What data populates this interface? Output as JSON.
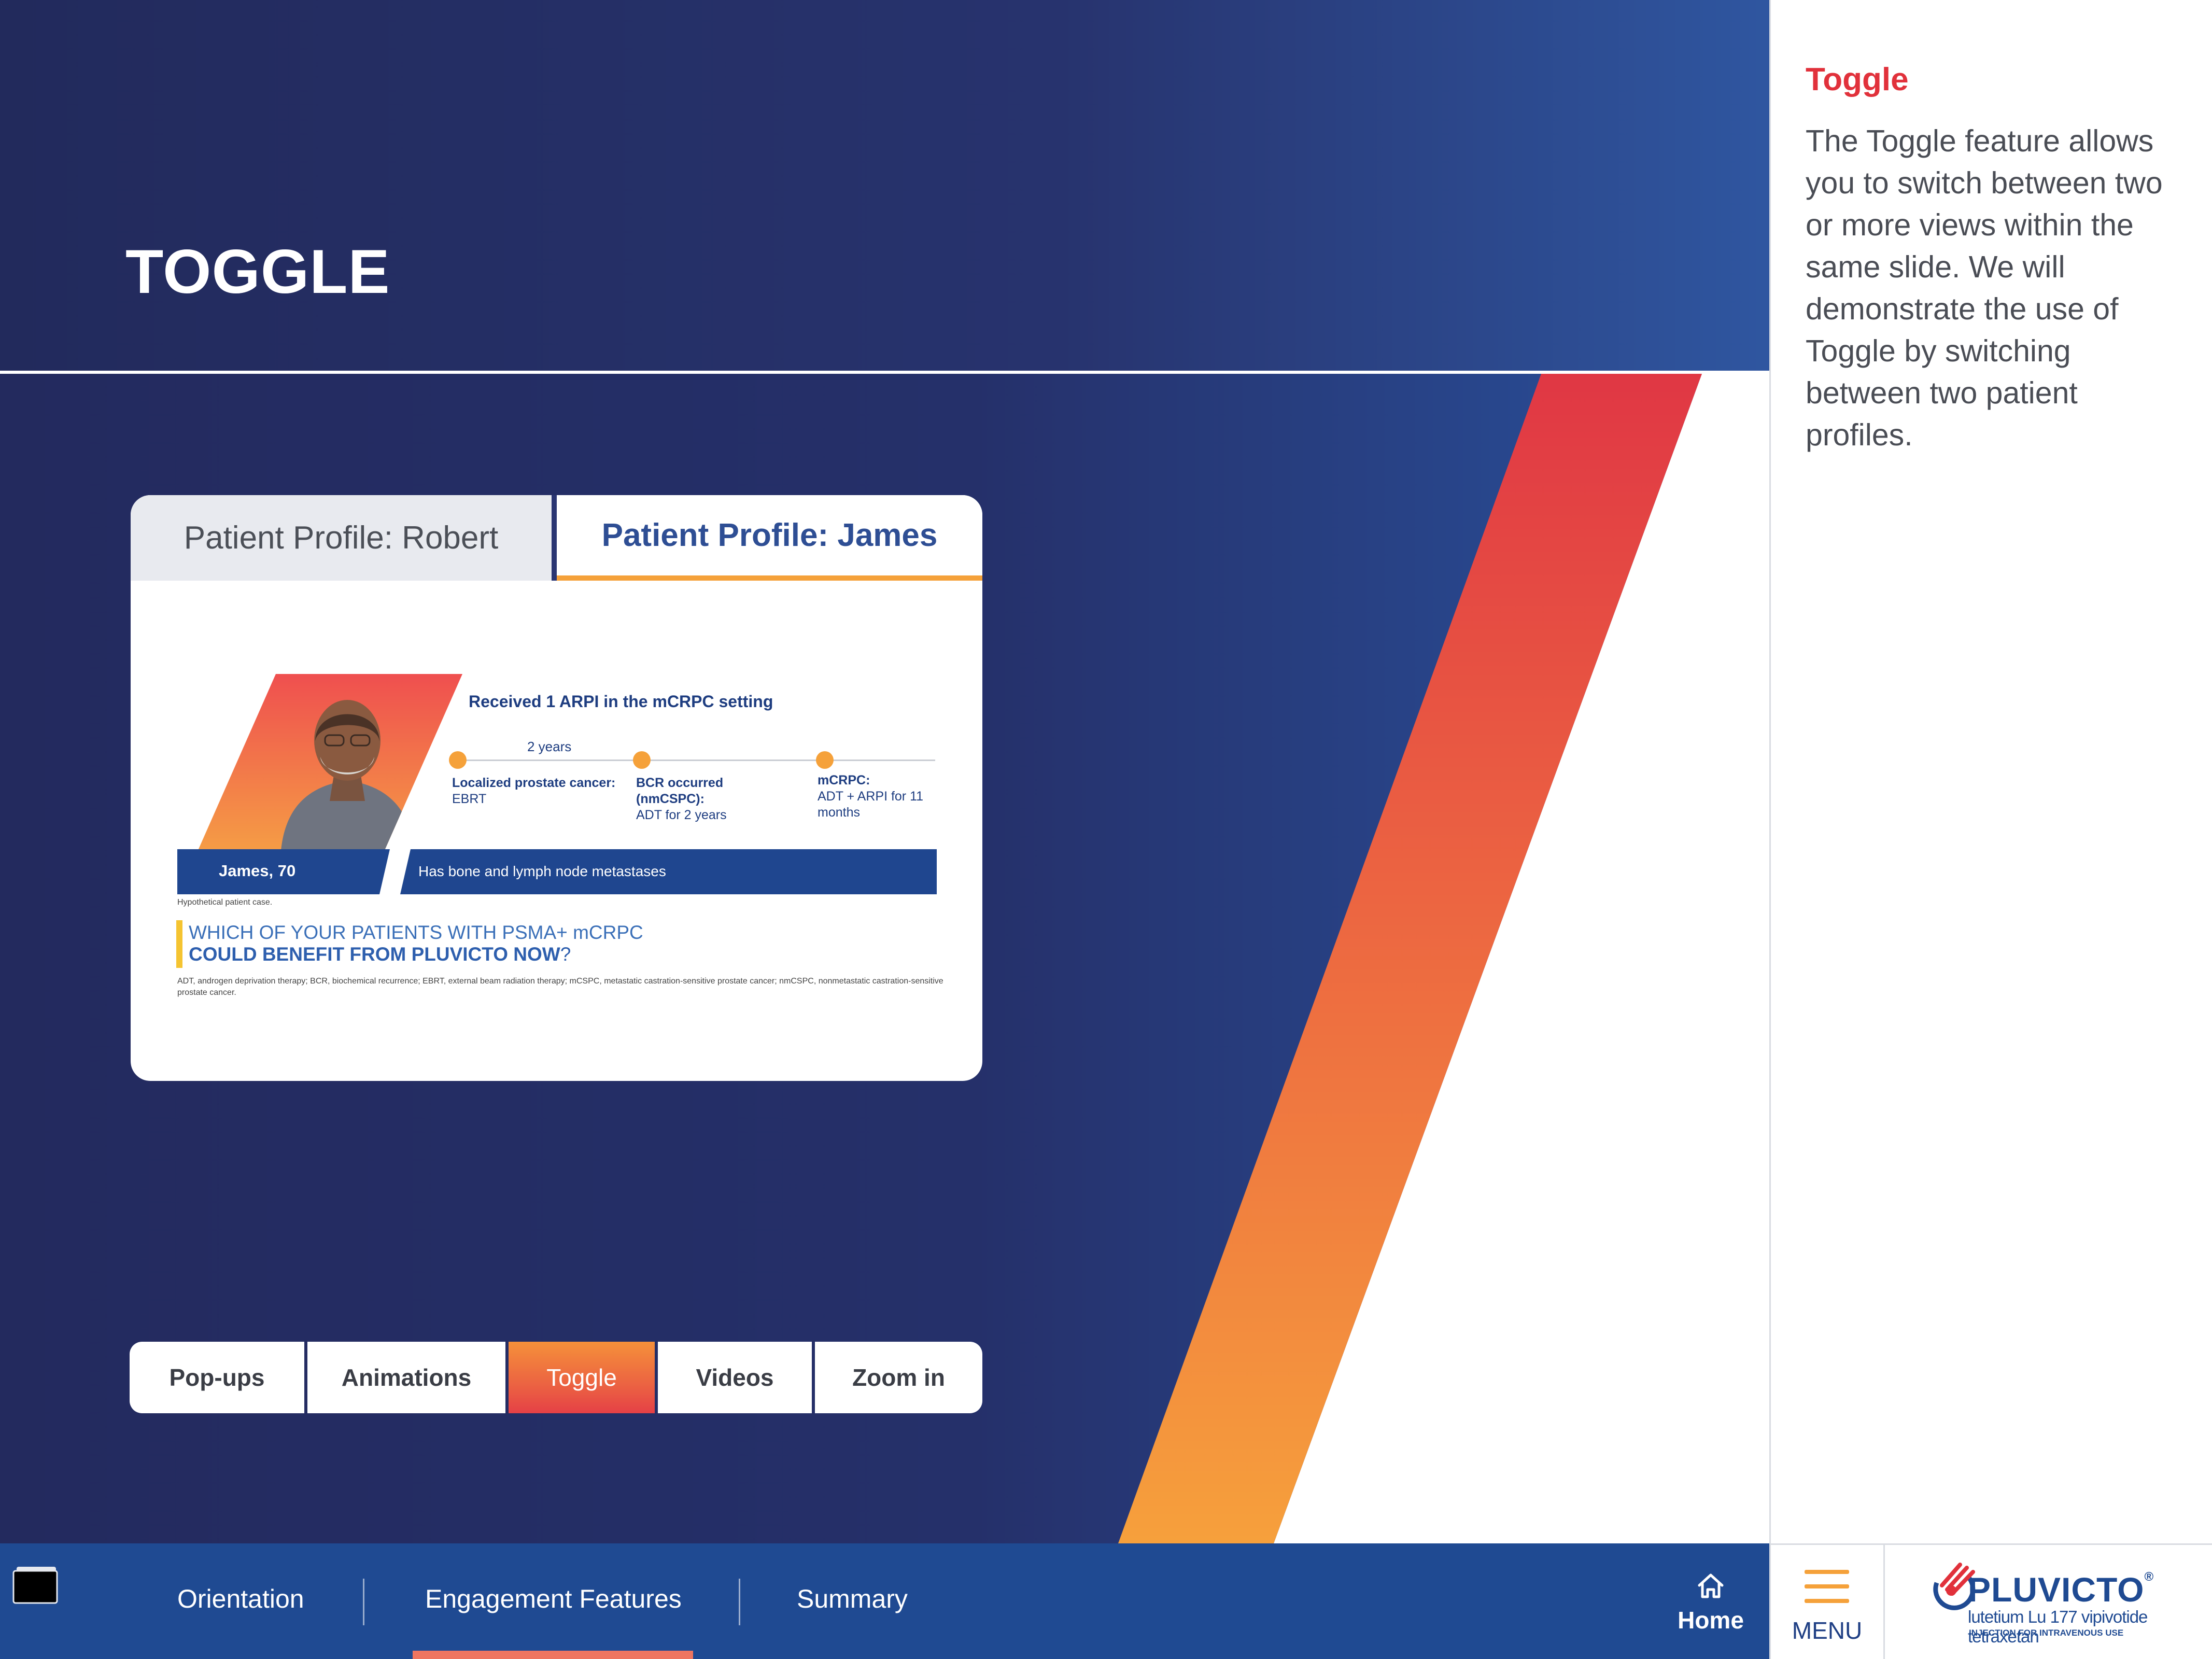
{
  "page": {
    "title": "TOGGLE"
  },
  "toggle_card": {
    "tabs": [
      {
        "label": "Patient Profile: Robert",
        "selected": false
      },
      {
        "label": "Patient Profile: James",
        "selected": true
      }
    ],
    "profile": {
      "headline": "Received 1 ARPI in the mCRPC setting",
      "timeline_span_label": "2 years",
      "milestones": [
        {
          "title": "Localized prostate cancer:",
          "detail": "EBRT"
        },
        {
          "title": "BCR occurred (nmCSPC):",
          "detail": "ADT for 2 years"
        },
        {
          "title": "mCRPC:",
          "detail": "ADT + ARPI for 11 months"
        }
      ],
      "name": "James, 70",
      "metastases": "Has bone and lymph node metastases",
      "hypothetical_note": "Hypothetical patient case.",
      "question_line1": "WHICH OF YOUR PATIENTS WITH PSMA+ mCRPC",
      "question_line2": "COULD BENEFIT FROM PLUVICTO NOW",
      "question_mark": "?",
      "abbreviations": "ADT, androgen deprivation therapy; BCR, biochemical recurrence; EBRT, external beam radiation therapy; mCSPC, metastatic castration-sensitive prostate cancer; nmCSPC, nonmetastatic castration-sensitive prostate cancer."
    }
  },
  "feature_tabs": [
    {
      "label": "Pop-ups",
      "active": false
    },
    {
      "label": "Animations",
      "active": false
    },
    {
      "label": "Toggle",
      "active": true
    },
    {
      "label": "Videos",
      "active": false
    },
    {
      "label": "Zoom in",
      "active": false
    }
  ],
  "bottom_nav": {
    "items": [
      {
        "label": "Orientation",
        "active": false
      },
      {
        "label": "Engagement Features",
        "active": true
      },
      {
        "label": "Summary",
        "active": false
      }
    ],
    "home_label": "Home",
    "menu_label": "MENU"
  },
  "side_panel": {
    "title": "Toggle",
    "body": "The Toggle feature allows you to switch between two or more views within the same slide. We will demonstrate the use of Toggle by switching between two patient profiles."
  },
  "brand": {
    "name": "PLUVICTO",
    "registered_mark": "®",
    "generic": "lutetium Lu 177 vipivotide tetraxetan",
    "route": "INJECTION FOR INTRAVENOUS USE"
  },
  "colors": {
    "accent_red": "#e1313b",
    "accent_orange": "#f5a13a",
    "navy": "#232a5e",
    "nav_blue": "#1f4a92"
  },
  "icons": [
    "home-icon",
    "hamburger-menu-icon",
    "window-stack-icon",
    "pluvicto-logo-icon"
  ]
}
